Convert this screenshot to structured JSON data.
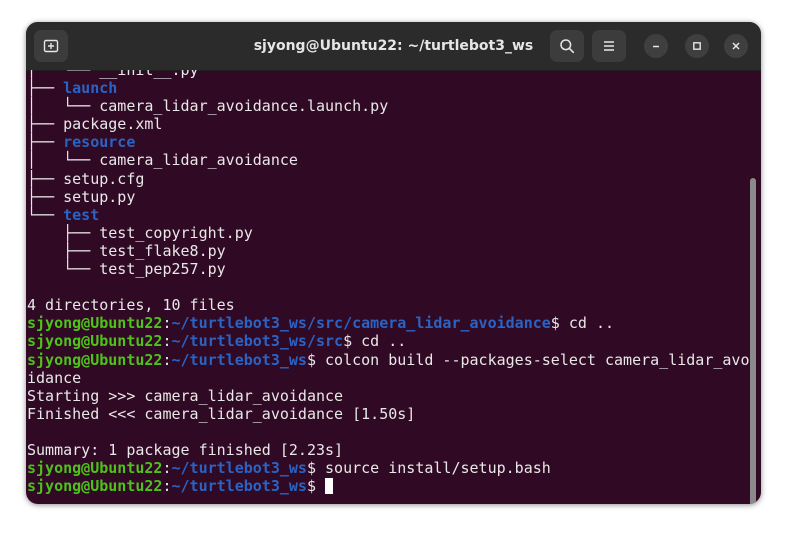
{
  "window": {
    "title": "sjyong@Ubuntu22: ~/turtlebot3_ws",
    "buttons": [
      "new-tab-icon",
      "search-icon",
      "menu-icon",
      "minimize-icon",
      "maximize-icon",
      "close-icon"
    ]
  },
  "colors": {
    "background": "#300a24",
    "directory": "#2a63c4",
    "prompt_user": "#4ec21a",
    "prompt_path": "#2a63c4",
    "text": "#e8e8e8"
  },
  "terminal": {
    "tree": [
      {
        "prefix": "│   └── ",
        "name": "__init__.py"
      },
      {
        "prefix": "├── ",
        "name": "launch",
        "dir": true
      },
      {
        "prefix": "│   └── ",
        "name": "camera_lidar_avoidance.launch.py"
      },
      {
        "prefix": "├── ",
        "name": "package.xml"
      },
      {
        "prefix": "├── ",
        "name": "resource",
        "dir": true
      },
      {
        "prefix": "│   └── ",
        "name": "camera_lidar_avoidance"
      },
      {
        "prefix": "├── ",
        "name": "setup.cfg"
      },
      {
        "prefix": "├── ",
        "name": "setup.py"
      },
      {
        "prefix": "└── ",
        "name": "test",
        "dir": true
      },
      {
        "prefix": "    ├── ",
        "name": "test_copyright.py"
      },
      {
        "prefix": "    ├── ",
        "name": "test_flake8.py"
      },
      {
        "prefix": "    └── ",
        "name": "test_pep257.py"
      }
    ],
    "summary": "4 directories, 10 files",
    "prompt_user": "sjyong@Ubuntu22",
    "prompt_colon": ":",
    "prompt_dollar": "$",
    "commands": [
      {
        "path": "~/turtlebot3_ws/src/camera_lidar_avoidance",
        "cmd": " cd .."
      },
      {
        "path": "~/turtlebot3_ws/src",
        "cmd": " cd .."
      },
      {
        "path": "~/turtlebot3_ws",
        "cmd": " colcon build --packages-select camera_lidar_avo"
      }
    ],
    "wrap_line": "idance",
    "output": [
      "Starting >>> camera_lidar_avoidance",
      "Finished <<< camera_lidar_avoidance [1.50s]"
    ],
    "summary2": "Summary: 1 package finished [2.23s]",
    "after": [
      {
        "path": "~/turtlebot3_ws",
        "cmd": " source install/setup.bash"
      }
    ],
    "last_prompt_path": "~/turtlebot3_ws"
  }
}
